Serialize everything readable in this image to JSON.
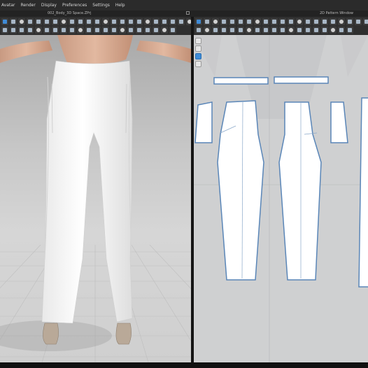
{
  "menu": [
    "Avatar",
    "Render",
    "Display",
    "Preferences",
    "Settings",
    "Help"
  ],
  "panels": {
    "view3d_title": "002_Body_3D Space.ZPrj",
    "view2d_title": "2D Pattern Window"
  },
  "colors": {
    "accent": "#3f8bd6",
    "pattern_outline": "#5a86b8",
    "garment": "#f7f7f7"
  },
  "icons": [
    "move-icon",
    "rotate-icon",
    "select-icon",
    "sew-icon",
    "pin-icon",
    "measure-icon",
    "text-icon",
    "zoom-icon"
  ]
}
